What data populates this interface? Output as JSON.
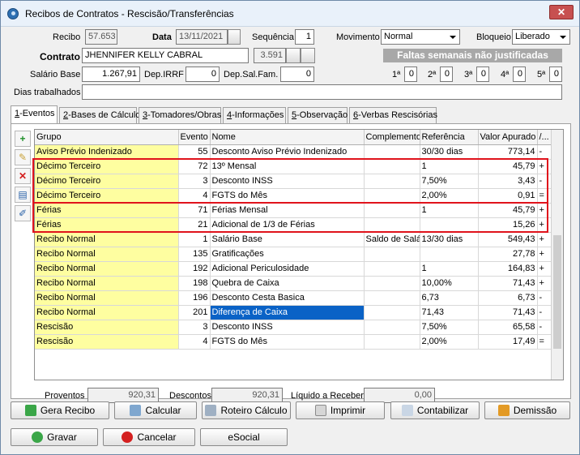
{
  "window": {
    "title": "Recibos de Contratos - Rescisão/Transferências",
    "close": "✕"
  },
  "header": {
    "recibo_label": "Recibo",
    "recibo_value": "57.653",
    "data_label": "Data",
    "data_value": "13/11/2021",
    "sequencia_label": "Sequência",
    "sequencia_value": "1",
    "movimento_label": "Movimento",
    "movimento_value": "Normal",
    "bloqueio_label": "Bloqueio",
    "bloqueio_value": "Liberado",
    "contrato_label": "Contrato",
    "contrato_value": "JHENNIFER KELLY CABRAL",
    "contrato_code": "3.591",
    "salario_label": "Salário Base",
    "salario_value": "1.267,91",
    "irrf_label": "Dep.IRRF",
    "irrf_value": "0",
    "salfam_label": "Dep.Sal.Fam.",
    "salfam_value": "0",
    "dias_label": "Dias trabalhados",
    "dias_value": "",
    "faltas_banner": "Faltas semanais não justificadas",
    "faltas": [
      {
        "label": "1ª",
        "value": "0"
      },
      {
        "label": "2ª",
        "value": "0"
      },
      {
        "label": "3ª",
        "value": "0"
      },
      {
        "label": "4ª",
        "value": "0"
      },
      {
        "label": "5ª",
        "value": "0"
      }
    ]
  },
  "tabs": [
    {
      "key": "1",
      "label": "-Eventos"
    },
    {
      "key": "2",
      "label": "-Bases de Cálculo"
    },
    {
      "key": "3",
      "label": "-Tomadores/Obras"
    },
    {
      "key": "4",
      "label": "-Informações"
    },
    {
      "key": "5",
      "label": "-Observação"
    },
    {
      "key": "6",
      "label": "-Verbas Rescisórias"
    }
  ],
  "grid": {
    "columns": [
      "Grupo",
      "Evento",
      "Nome",
      "Complemento",
      "Referência",
      "Valor Apurado",
      "/..."
    ],
    "rows": [
      {
        "grupo": "Aviso Prévio Indenizado",
        "evento": "55",
        "nome": "Desconto Aviso Prévio Indenizado",
        "comp": "",
        "ref": "30/30 dias",
        "valor": "773,14",
        "sig": "-"
      },
      {
        "grupo": "Décimo Terceiro",
        "evento": "72",
        "nome": "13º Mensal",
        "comp": "",
        "ref": "1",
        "valor": "45,79",
        "sig": "+"
      },
      {
        "grupo": "Décimo Terceiro",
        "evento": "3",
        "nome": "Desconto INSS",
        "comp": "",
        "ref": "7,50%",
        "valor": "3,43",
        "sig": "-"
      },
      {
        "grupo": "Décimo Terceiro",
        "evento": "4",
        "nome": "FGTS do Mês",
        "comp": "",
        "ref": "2,00%",
        "valor": "0,91",
        "sig": "="
      },
      {
        "grupo": "Férias",
        "evento": "71",
        "nome": "Férias Mensal",
        "comp": "",
        "ref": "1",
        "valor": "45,79",
        "sig": "+"
      },
      {
        "grupo": "Férias",
        "evento": "21",
        "nome": "Adicional de 1/3 de Férias",
        "comp": "",
        "ref": "",
        "valor": "15,26",
        "sig": "+"
      },
      {
        "grupo": "Recibo Normal",
        "evento": "1",
        "nome": "Salário Base",
        "comp": "Saldo de Salár",
        "ref": "13/30 dias",
        "valor": "549,43",
        "sig": "+"
      },
      {
        "grupo": "Recibo Normal",
        "evento": "135",
        "nome": "Gratificações",
        "comp": "",
        "ref": "",
        "valor": "27,78",
        "sig": "+"
      },
      {
        "grupo": "Recibo Normal",
        "evento": "192",
        "nome": "Adicional Periculosidade",
        "comp": "",
        "ref": "1",
        "valor": "164,83",
        "sig": "+"
      },
      {
        "grupo": "Recibo Normal",
        "evento": "198",
        "nome": "Quebra de Caixa",
        "comp": "",
        "ref": "10,00%",
        "valor": "71,43",
        "sig": "+"
      },
      {
        "grupo": "Recibo Normal",
        "evento": "196",
        "nome": "Desconto Cesta Basica",
        "comp": "",
        "ref": "6,73",
        "valor": "6,73",
        "sig": "-"
      },
      {
        "grupo": "Recibo Normal",
        "evento": "201",
        "nome": "Diferença de Caixa",
        "comp": "",
        "ref": "71,43",
        "valor": "71,43",
        "sig": "-"
      },
      {
        "grupo": "Rescisão",
        "evento": "3",
        "nome": "Desconto INSS",
        "comp": "",
        "ref": "7,50%",
        "valor": "65,58",
        "sig": "-"
      },
      {
        "grupo": "Rescisão",
        "evento": "4",
        "nome": "FGTS do Mês",
        "comp": "",
        "ref": "2,00%",
        "valor": "17,49",
        "sig": "="
      }
    ]
  },
  "totals": {
    "proventos_label": "Proventos",
    "proventos_value": "920,31",
    "descontos_label": "Descontos",
    "descontos_value": "920,31",
    "liquido_label": "Líquido a Receber",
    "liquido_value": "0,00"
  },
  "buttons": {
    "gera_recibo": "Gera Recibo",
    "calcular": "Calcular",
    "roteiro": "Roteiro Cálculo",
    "imprimir": "Imprimir",
    "contabilizar": "Contabilizar",
    "demissao": "Demissão",
    "gravar": "Gravar",
    "cancelar": "Cancelar",
    "esocial": "eSocial"
  },
  "colors": {
    "group_cell": "#fefea0",
    "selection": "#0a62c6",
    "highlight_border": "#e0131c"
  }
}
